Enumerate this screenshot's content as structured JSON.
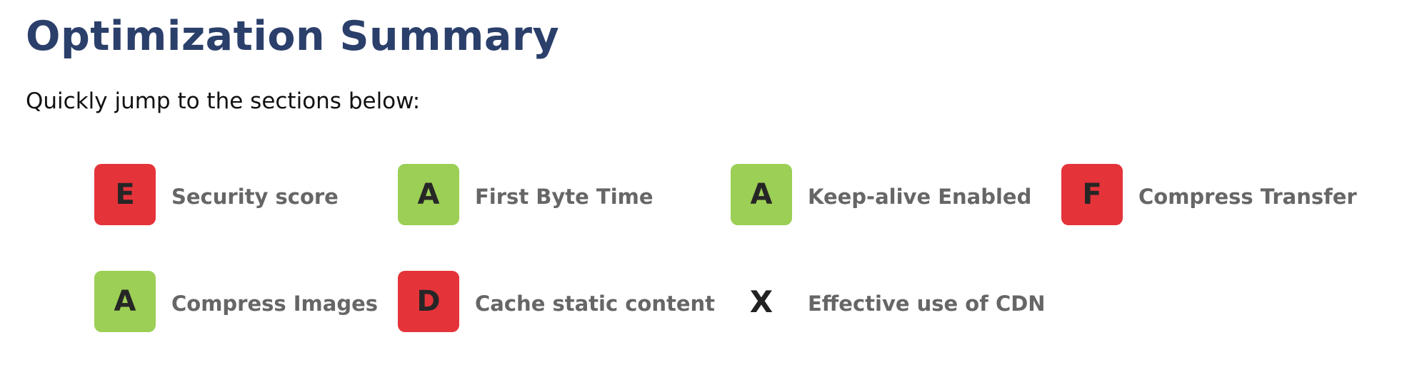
{
  "header": {
    "title": "Optimization Summary",
    "subtitle": "Quickly jump to the sections below:"
  },
  "colors": {
    "title": "#2b3f6b",
    "grade_bad": "#e5333a",
    "grade_good": "#9ccf55",
    "label": "#666666"
  },
  "items": [
    {
      "grade": "E",
      "label": "Security score",
      "status": "bad"
    },
    {
      "grade": "A",
      "label": "First Byte Time",
      "status": "good"
    },
    {
      "grade": "A",
      "label": "Keep-alive Enabled",
      "status": "good"
    },
    {
      "grade": "F",
      "label": "Compress Transfer",
      "status": "bad"
    },
    {
      "grade": "A",
      "label": "Compress Images",
      "status": "good"
    },
    {
      "grade": "D",
      "label": "Cache static content",
      "status": "bad"
    },
    {
      "grade": "X",
      "label": "Effective use of CDN",
      "status": "none"
    }
  ]
}
